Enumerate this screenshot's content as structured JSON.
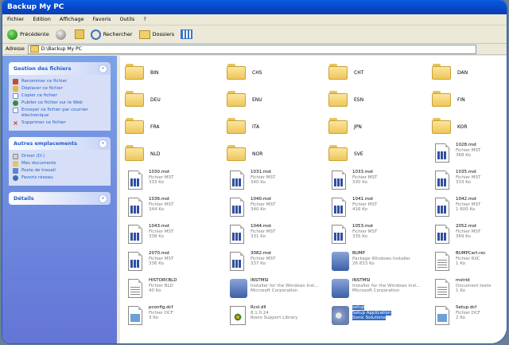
{
  "window": {
    "title": "Backup My PC"
  },
  "menu": [
    "Fichier",
    "Edition",
    "Affichage",
    "Favoris",
    "Outils",
    "?"
  ],
  "toolbar": {
    "back": "Précédente",
    "search": "Rechercher",
    "folders": "Dossiers"
  },
  "address": {
    "label": "Adresse",
    "path": "D:\\Backup My PC"
  },
  "sidebar": {
    "file_tasks": {
      "title": "Gestion des fichiers",
      "items": [
        "Renommer ce fichier",
        "Déplacer ce fichier",
        "Copier ce fichier",
        "Publier ce fichier sur le Web",
        "Envoyer ce fichier par courrier électronique",
        "Supprimer ce fichier"
      ]
    },
    "other_places": {
      "title": "Autres emplacements",
      "items": [
        "Driver (D:)",
        "Mes documents",
        "Poste de travail",
        "Favoris réseau"
      ]
    },
    "details": {
      "title": "Détails"
    }
  },
  "folders": [
    "BIN",
    "CHS",
    "CHT",
    "DAN",
    "DEU",
    "ENU",
    "ESN",
    "FIN",
    "FRA",
    "ITA",
    "JPN",
    "KOR",
    "NLD",
    "NOR",
    "SVE"
  ],
  "files": [
    {
      "name": "1028.mst",
      "type": "Fichier MST",
      "size": "368 Ko"
    },
    {
      "name": "1030.mst",
      "type": "Fichier MST",
      "size": "333 Ko"
    },
    {
      "name": "1031.mst",
      "type": "Fichier MST",
      "size": "340 Ko"
    },
    {
      "name": "1033.mst",
      "type": "Fichier MST",
      "size": "330 Ko"
    },
    {
      "name": "1035.mst",
      "type": "Fichier MST",
      "size": "333 Ko"
    },
    {
      "name": "1036.mst",
      "type": "Fichier MST",
      "size": "344 Ko"
    },
    {
      "name": "1040.mst",
      "type": "Fichier MST",
      "size": "340 Ko"
    },
    {
      "name": "1041.mst",
      "type": "Fichier MST",
      "size": "416 Ko"
    },
    {
      "name": "1042.mst",
      "type": "Fichier MST",
      "size": "1 600 Ko"
    },
    {
      "name": "1043.mst",
      "type": "Fichier MST",
      "size": "338 Ko"
    },
    {
      "name": "1044.mst",
      "type": "Fichier MST",
      "size": "331 Ko"
    },
    {
      "name": "1053.mst",
      "type": "Fichier MST",
      "size": "335 Ko"
    },
    {
      "name": "2052.mst",
      "type": "Fichier MST",
      "size": "369 Ko"
    },
    {
      "name": "2070.mst",
      "type": "Fichier MST",
      "size": "336 Ko"
    },
    {
      "name": "3082.mst",
      "type": "Fichier MST",
      "size": "337 Ko"
    },
    {
      "name": "BUMP",
      "type": "Package Windows Installer",
      "size": "26 833 Ko"
    },
    {
      "name": "BUMPCert.rxc",
      "type": "Fichier RXC",
      "size": "1 Ko"
    },
    {
      "name": "HISTORY.BLD",
      "type": "Fichier BLD",
      "size": "40 Ko"
    },
    {
      "name": "INSTMSI",
      "type": "Installer for the Windows Inst...",
      "size": "Microsoft Corporation"
    },
    {
      "name": "INSTMSI",
      "type": "Installer for the Windows Inst...",
      "size": "Microsoft Corporation"
    },
    {
      "name": "mstrid",
      "type": "Document texte",
      "size": "1 Ko"
    },
    {
      "name": "pconfig.dcf",
      "type": "Fichier DCF",
      "size": "3 Ko"
    },
    {
      "name": "Rcsl.dll",
      "type": "8.1.0.24",
      "size": "Roxio Support Library"
    },
    {
      "name": "setup",
      "type": "Setup Application",
      "size": "Sonic Solutions"
    },
    {
      "name": "Setup.dcf",
      "type": "Fichier DCF",
      "size": "2 Ko"
    }
  ]
}
